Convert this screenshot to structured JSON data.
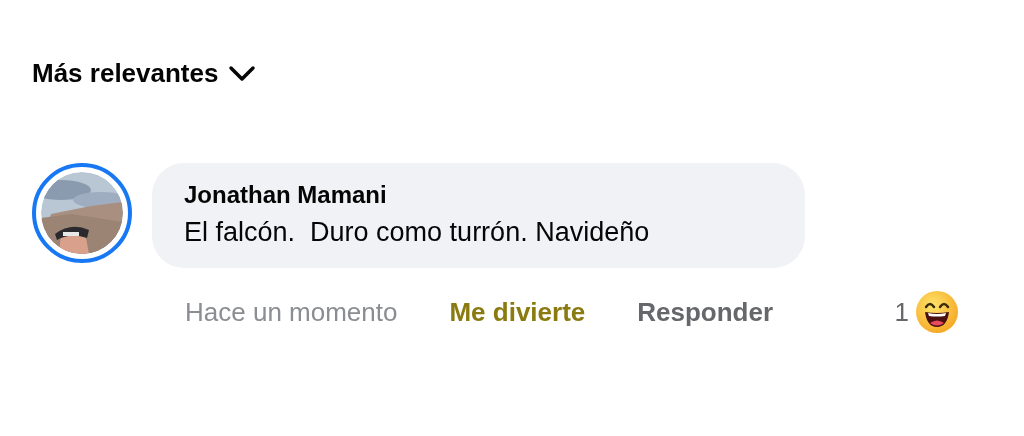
{
  "sort": {
    "label": "Más relevantes"
  },
  "comment": {
    "avatar": {
      "kind": "picture",
      "story_ring": true
    },
    "author": "Jonathan Mamani",
    "text": "El falcón.  Duro como turrón. Navideño",
    "actions": [
      {
        "kind": "time",
        "label": "Hace un momento",
        "reacted": false
      },
      {
        "kind": "react",
        "label": "Me divierte",
        "reacted": true
      },
      {
        "kind": "reply",
        "label": "Responder",
        "reacted": false
      }
    ],
    "reactions": {
      "count": "1"
    }
  }
}
